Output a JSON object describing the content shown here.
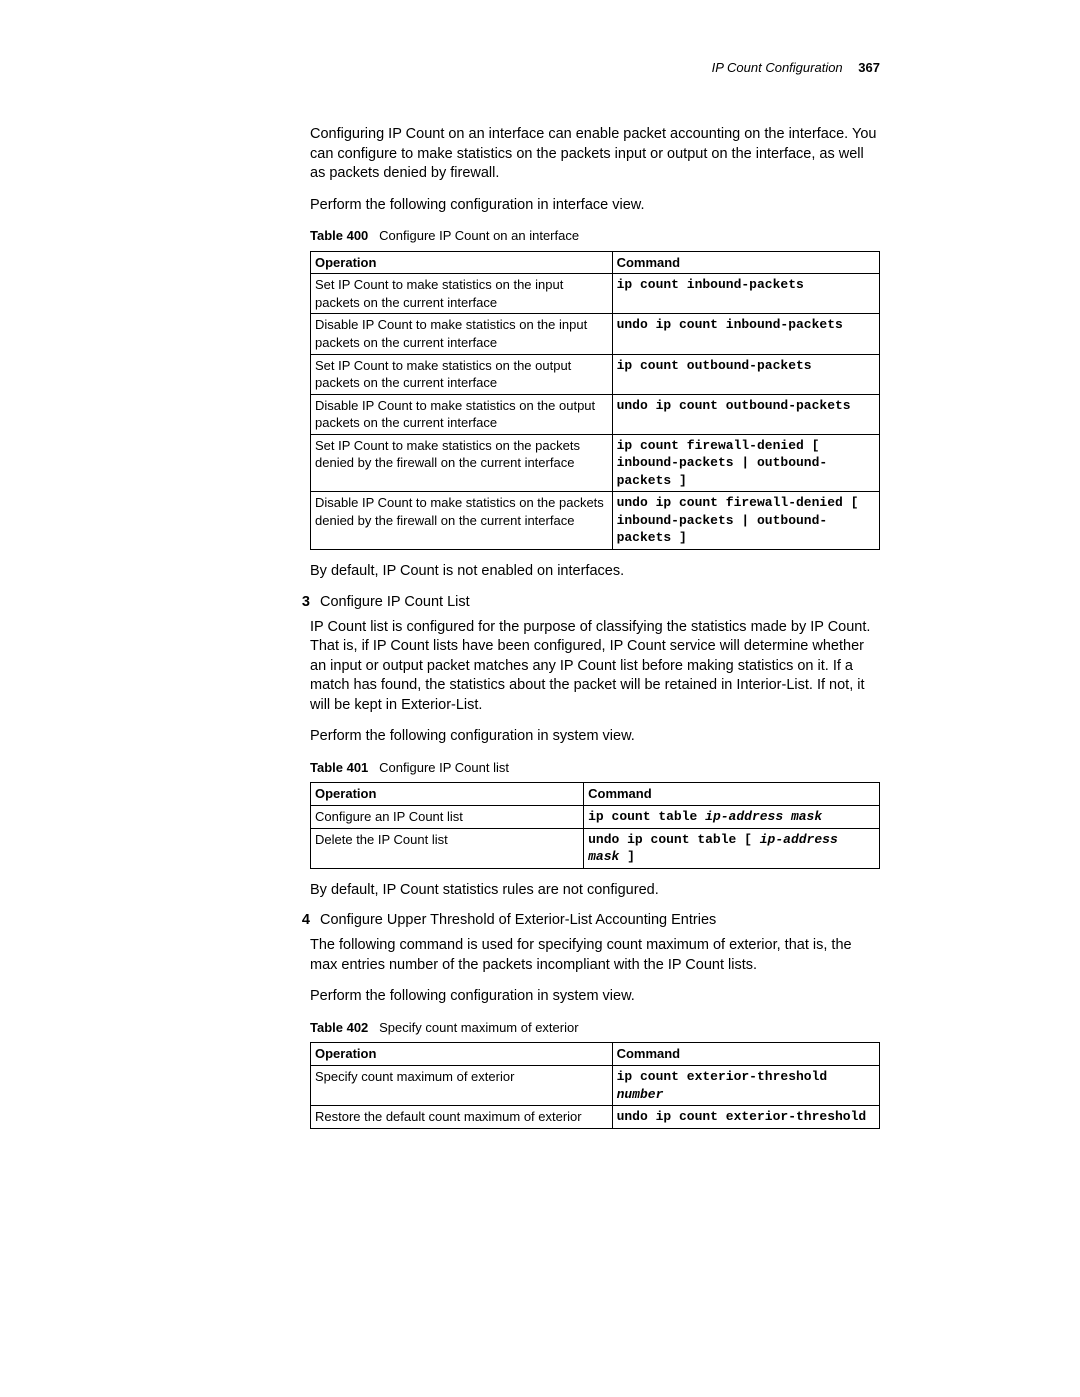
{
  "header": {
    "title": "IP Count Configuration",
    "page": "367"
  },
  "intro_para": "Configuring IP Count on an interface can enable packet accounting on the interface. You can configure to make statistics on the packets input or output on the interface, as well as packets denied by firewall.",
  "intro_perform": "Perform the following configuration in interface view.",
  "table400": {
    "label": "Table 400",
    "caption": "Configure IP Count on an interface",
    "col_op": "Operation",
    "col_cmd": "Command",
    "rows": [
      {
        "op": "Set IP Count to make statistics on the input packets on the current interface",
        "cmd": "ip count inbound-packets"
      },
      {
        "op": "Disable IP Count to make statistics on the input packets on the current interface",
        "cmd": "undo ip count inbound-packets"
      },
      {
        "op": "Set IP Count to make statistics on the output packets on the current interface",
        "cmd": "ip count outbound-packets"
      },
      {
        "op": "Disable IP Count to make statistics on the output packets on the current interface",
        "cmd": "undo ip count outbound-packets"
      },
      {
        "op": "Set IP Count to make statistics on the packets denied by the firewall on the current interface",
        "cmd": "ip count firewall-denied [ inbound-packets | outbound-packets ]"
      },
      {
        "op": "Disable IP Count to make statistics on the packets denied by the firewall on the current interface",
        "cmd": "undo ip count firewall-denied [ inbound-packets | outbound-packets ]"
      }
    ]
  },
  "after_t400": "By default, IP Count is not enabled on interfaces.",
  "step3": {
    "num": "3",
    "title": "Configure IP Count List"
  },
  "step3_para": "IP Count list is configured for the purpose of classifying the statistics made by IP Count. That is, if IP Count lists have been configured, IP Count service will determine whether an input or output packet matches any IP Count list before making statistics on it. If a match has found, the statistics about the packet will be retained in Interior-List. If not, it will be kept in Exterior-List.",
  "step3_perform": "Perform the following configuration in system view.",
  "table401": {
    "label": "Table 401",
    "caption": "Configure IP Count list",
    "col_op": "Operation",
    "col_cmd": "Command",
    "rows": [
      {
        "op": "Configure an IP Count list",
        "cmd_pre": "ip count table ",
        "cmd_var": "ip-address mask",
        "cmd_post": ""
      },
      {
        "op": "Delete the IP Count list",
        "cmd_pre": "undo ip count table [ ",
        "cmd_var": "ip-address mask",
        "cmd_post": " ]"
      }
    ]
  },
  "after_t401": "By default, IP Count statistics rules are not configured.",
  "step4": {
    "num": "4",
    "title": "Configure Upper Threshold of Exterior-List Accounting Entries"
  },
  "step4_para": "The following command is used for specifying count maximum of exterior, that is, the max entries number of the packets incompliant with the IP Count lists.",
  "step4_perform": "Perform the following configuration in system view.",
  "table402": {
    "label": "Table 402",
    "caption": "Specify count maximum of exterior",
    "col_op": "Operation",
    "col_cmd": "Command",
    "rows": [
      {
        "op": "Specify count maximum of exterior",
        "cmd_pre": "ip count exterior-threshold ",
        "cmd_var": "number",
        "cmd_post": ""
      },
      {
        "op": "Restore the default count maximum of exterior",
        "cmd_pre": "undo ip count exterior-threshold",
        "cmd_var": "",
        "cmd_post": ""
      }
    ]
  }
}
